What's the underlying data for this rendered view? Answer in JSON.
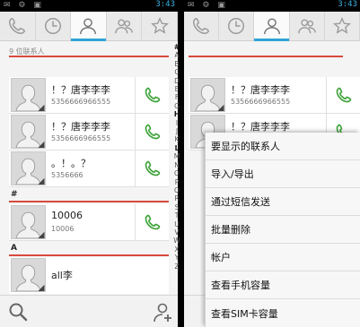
{
  "status": {
    "time": "3:43"
  },
  "tabs": [
    {
      "icon": "phone-icon"
    },
    {
      "icon": "clock-icon"
    },
    {
      "icon": "person-icon",
      "active": true
    },
    {
      "icon": "group-icon"
    },
    {
      "icon": "star-icon"
    }
  ],
  "contacts_count": "9 位联系人",
  "contacts": [
    {
      "name": "！？唐李李李",
      "number": "5356666966555"
    },
    {
      "name": "！？唐李李李",
      "number": "5356666966555"
    },
    {
      "name": "。！。？",
      "number": "5356666"
    },
    {
      "name": "10006",
      "number": "10006"
    },
    {
      "name": "all李",
      "number": ""
    }
  ],
  "section_letters": [
    "#",
    "A"
  ],
  "alphabet": [
    "#",
    "A",
    "B",
    "C",
    "D",
    "E",
    "F",
    "G",
    "H",
    "I",
    "J",
    "K",
    "L",
    "M",
    "N",
    "O",
    "P",
    "Q",
    "R",
    "S",
    "T",
    "U",
    "V",
    "W",
    "X",
    "Y",
    "Z"
  ],
  "menu": {
    "items": [
      "要显示的联系人",
      "导入/导出",
      "通过短信发送",
      "批量删除",
      "帐户",
      "查看手机容量",
      "查看SIM卡容量"
    ]
  },
  "colors": {
    "accent": "#2ea4d6",
    "divider": "#d84a3d",
    "call_green": "#3fa33a"
  }
}
